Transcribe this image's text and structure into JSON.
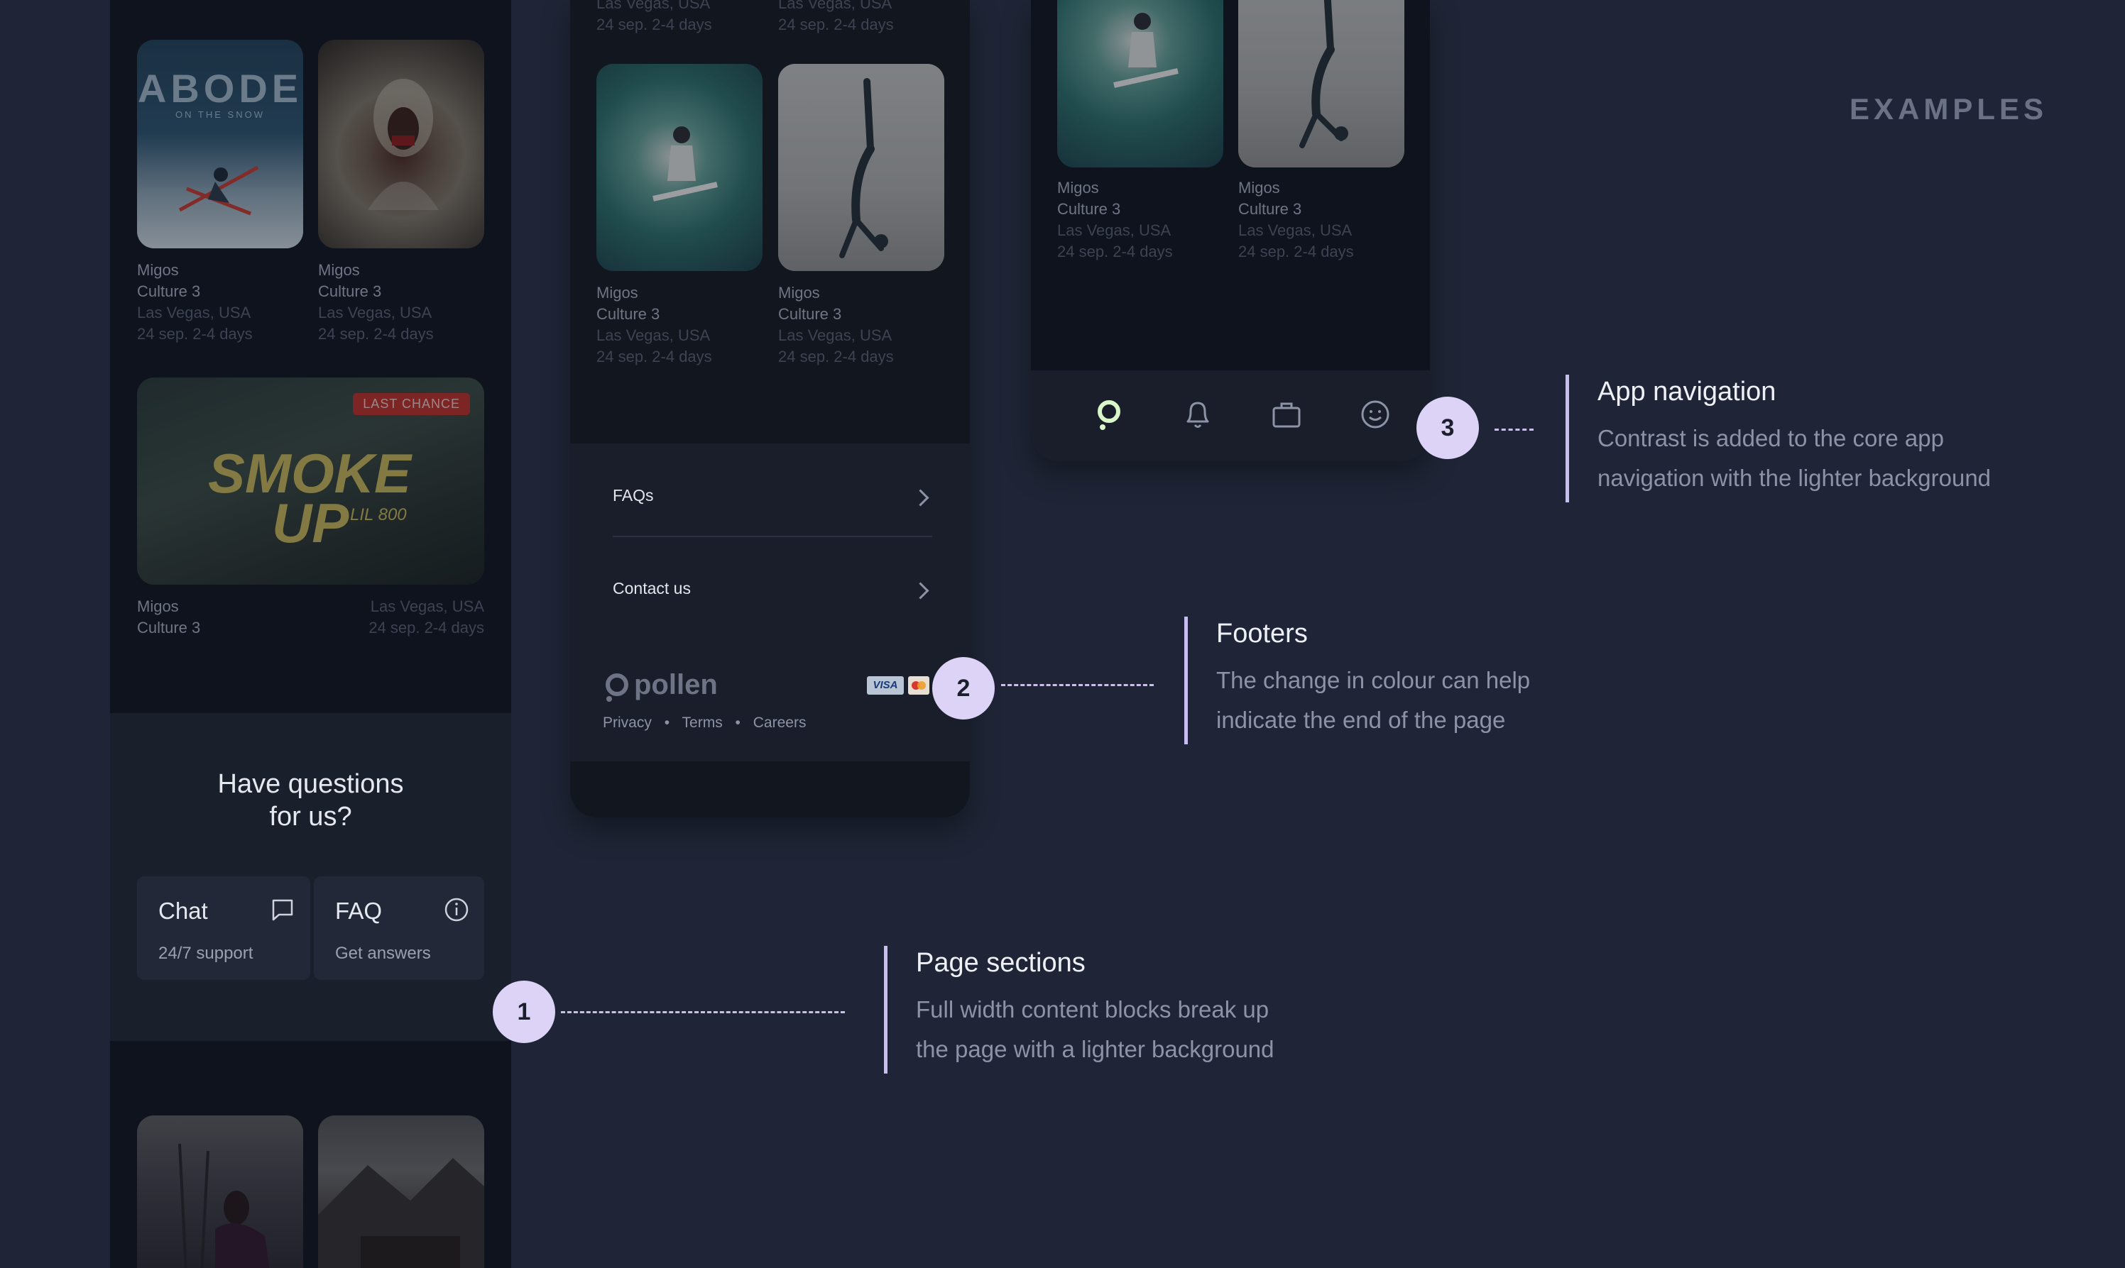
{
  "header": {
    "examples_label": "EXAMPLES"
  },
  "left_phone": {
    "top_cards": [
      {
        "title": "Migos",
        "subtitle": "Culture 3",
        "location": "Las Vegas, USA",
        "date": "24 sep. 2-4 days",
        "poster_title": "ABODE",
        "poster_sub": "ON THE SNOW"
      },
      {
        "title": "Migos",
        "subtitle": "Culture 3",
        "location": "Las Vegas, USA",
        "date": "24 sep. 2-4 days"
      }
    ],
    "wide_card": {
      "badge": "LAST CHANCE",
      "poster_title": "SMOKE",
      "poster_title2": "UP",
      "poster_sub": "LIL 800",
      "title": "Migos",
      "subtitle": "Culture 3",
      "location": "Las Vegas, USA",
      "date": "24 sep. 2-4 days"
    },
    "questions": {
      "heading_line1": "Have questions",
      "heading_line2": "for us?",
      "chat_label": "Chat",
      "chat_sub": "24/7 support",
      "faq_label": "FAQ",
      "faq_sub": "Get answers"
    }
  },
  "mid_phone": {
    "top_partial": [
      {
        "location": "Las Vegas, USA",
        "date": "24 sep. 2-4 days"
      },
      {
        "location": "Las Vegas, USA",
        "date": "24 sep. 2-4 days"
      }
    ],
    "cards": [
      {
        "title": "Migos",
        "subtitle": "Culture 3",
        "location": "Las Vegas, USA",
        "date": "24 sep. 2-4 days"
      },
      {
        "title": "Migos",
        "subtitle": "Culture 3",
        "location": "Las Vegas, USA",
        "date": "24 sep. 2-4 days"
      }
    ],
    "footer": {
      "faqs": "FAQs",
      "contact": "Contact us",
      "brand": "pollen",
      "links": [
        "Privacy",
        "Terms",
        "Careers"
      ],
      "card_visa": "VISA"
    }
  },
  "right_phone": {
    "cards": [
      {
        "title": "Migos",
        "subtitle": "Culture 3",
        "location": "Las Vegas, USA",
        "date": "24 sep. 2-4 days"
      },
      {
        "title": "Migos",
        "subtitle": "Culture 3",
        "location": "Las Vegas, USA",
        "date": "24 sep. 2-4 days"
      }
    ],
    "nav_icons": [
      "home-ring-icon",
      "bell-icon",
      "briefcase-icon",
      "smiley-icon"
    ]
  },
  "annotations": [
    {
      "number": "1",
      "title": "Page sections",
      "line1": "Full width content blocks break up",
      "line2": "the page with a lighter background"
    },
    {
      "number": "2",
      "title": "Footers",
      "line1": "The change in colour can help",
      "line2": "indicate the end of the page"
    },
    {
      "number": "3",
      "title": "App navigation",
      "line1": "Contrast is added to the core app",
      "line2": "navigation with the lighter background"
    }
  ],
  "colors": {
    "background": "#1f2536",
    "badge": "#dcd3f7",
    "callout_bar": "#c8bdf0",
    "last_chance": "#b8322c",
    "nav_active": "#d9f7c8"
  }
}
